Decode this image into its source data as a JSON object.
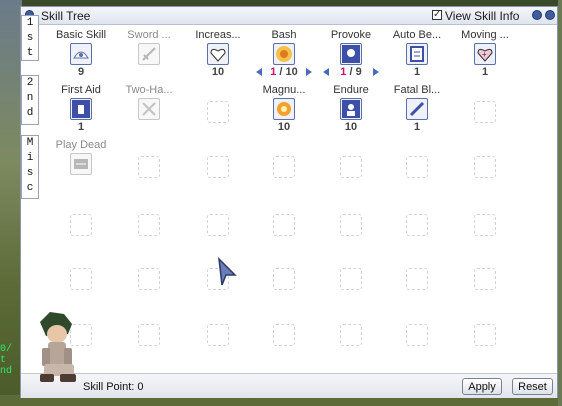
{
  "window": {
    "title": "Skill Tree",
    "view_info_checked": "✓",
    "view_info_label": "View Skill Info"
  },
  "tabs": [
    {
      "label_chars": [
        "1",
        "s",
        "t"
      ]
    },
    {
      "label_chars": [
        "2",
        "n",
        "d"
      ]
    },
    {
      "label_chars": [
        "M",
        "i",
        "s",
        "c"
      ]
    }
  ],
  "skills": [
    {
      "name": "Basic Skill",
      "level": "9",
      "state": "learned",
      "icon": "basic-skill-icon"
    },
    {
      "name": "Sword ...",
      "level": "",
      "state": "locked",
      "icon": "sword-mastery-icon"
    },
    {
      "name": "Increas...",
      "level": "10",
      "state": "learned",
      "icon": "increase-hp-recovery-icon"
    },
    {
      "name": "Bash",
      "level_current": "1",
      "level_sep": " / ",
      "level_max": "10",
      "state": "adjustable",
      "icon": "bash-icon"
    },
    {
      "name": "Provoke",
      "level_current": "1",
      "level_sep": " / ",
      "level_max": "9",
      "state": "adjustable",
      "icon": "provoke-icon"
    },
    {
      "name": "Auto Be...",
      "level": "1",
      "state": "learned",
      "icon": "auto-berserk-icon"
    },
    {
      "name": "Moving ...",
      "level": "1",
      "state": "learned",
      "icon": "moving-hp-recovery-icon"
    },
    {
      "name": "First Aid",
      "level": "1",
      "state": "learned",
      "icon": "first-aid-icon"
    },
    {
      "name": "Two-Ha...",
      "level": "",
      "state": "locked",
      "icon": "two-hand-sword-icon"
    },
    {
      "name": "Magnu...",
      "level": "10",
      "state": "learned",
      "icon": "magnum-break-icon"
    },
    {
      "name": "Endure",
      "level": "10",
      "state": "learned",
      "icon": "endure-icon"
    },
    {
      "name": "Fatal Bl...",
      "level": "1",
      "state": "learned",
      "icon": "fatal-blow-icon"
    },
    {
      "name": "Play Dead",
      "level": "",
      "state": "locked",
      "icon": "play-dead-icon"
    }
  ],
  "footer": {
    "skill_point_label": "Skill Point: 0",
    "apply_label": "Apply",
    "reset_label": "Reset"
  },
  "side_text": [
    "0/",
    "t",
    "nd"
  ]
}
